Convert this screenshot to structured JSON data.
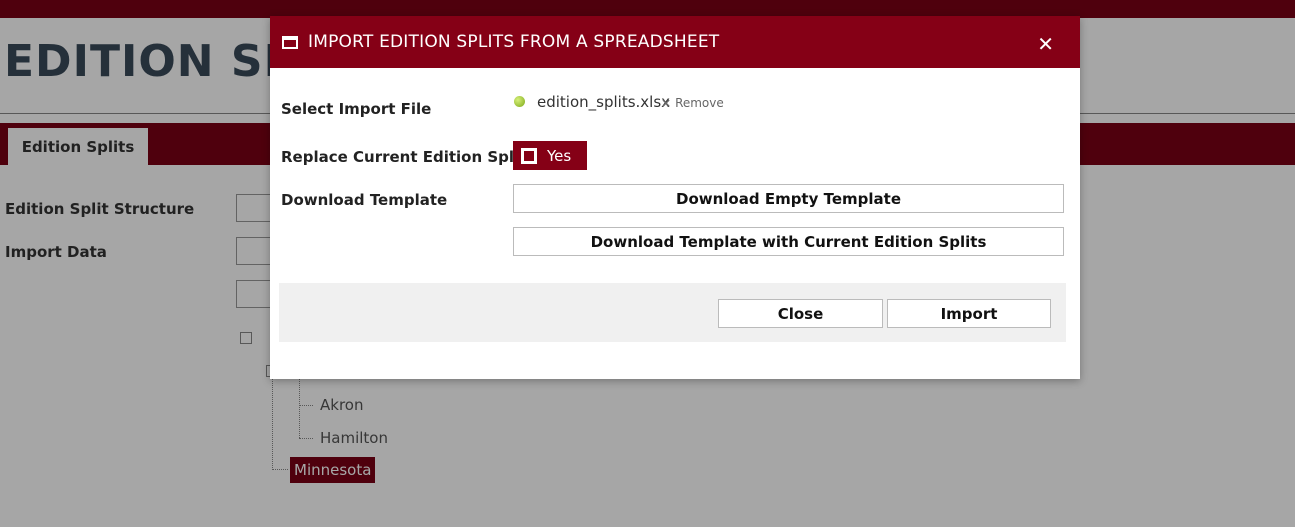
{
  "background": {
    "page_title": "EDITION SPLITS",
    "tab_label": "Edition Splits",
    "labels": {
      "edition_split_structure": "Edition Split Structure",
      "import_data": "Import Data"
    },
    "tree": {
      "nodes": [
        "Akron",
        "Hamilton",
        "Minnesota"
      ],
      "selected": "Minnesota"
    }
  },
  "modal": {
    "title": "IMPORT EDITION SPLITS FROM A SPREADSHEET",
    "close_icon": "close-icon",
    "select_file_label": "Select Import File",
    "file_name": "edition_splits.xlsx",
    "remove_label": "Remove",
    "remove_glyph": "×",
    "replace_label": "Replace Current Edition Splits",
    "replace_value": "Yes",
    "download_label": "Download Template",
    "download_empty": "Download Empty Template",
    "download_current": "Download Template with Current Edition Splits",
    "close_button": "Close",
    "import_button": "Import",
    "colors": {
      "header": "#850016",
      "file_status": "#9bc22b"
    }
  }
}
